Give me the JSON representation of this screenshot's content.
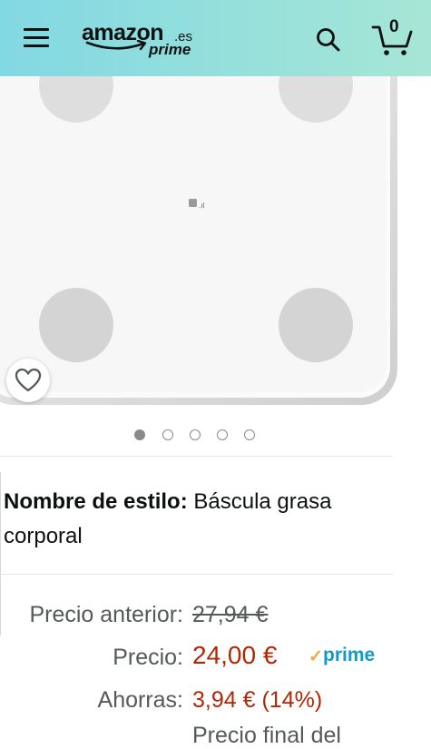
{
  "header": {
    "logo_main": "amazon",
    "logo_tld": ".es",
    "logo_sub": "prime",
    "cart_count": "0",
    "menu_icon": "hamburger-menu-icon",
    "search_icon": "search-icon",
    "cart_icon": "cart-icon",
    "gradient_start": "#82d8e3",
    "gradient_end": "#a6e6d6"
  },
  "gallery": {
    "image_count": 5,
    "active_index": 0,
    "wishlist_icon": "heart-outline-icon",
    "brand_mark": "mi"
  },
  "product": {
    "style_label": "Nombre de estilo:",
    "style_value": "Báscula grasa corporal"
  },
  "pricing": {
    "previous_label": "Precio anterior:",
    "previous_value": "27,94 €",
    "price_label": "Precio:",
    "price_value": "24,00 €",
    "prime_check": "✓",
    "prime_label": "prime",
    "savings_label": "Ahorras:",
    "savings_value": "3,94 € (14%)",
    "next_line_partial": "Precio final del"
  },
  "colors": {
    "price": "#b12704",
    "prime_blue": "#1399c6",
    "prime_check": "#f3a847",
    "muted_text": "#565959"
  }
}
